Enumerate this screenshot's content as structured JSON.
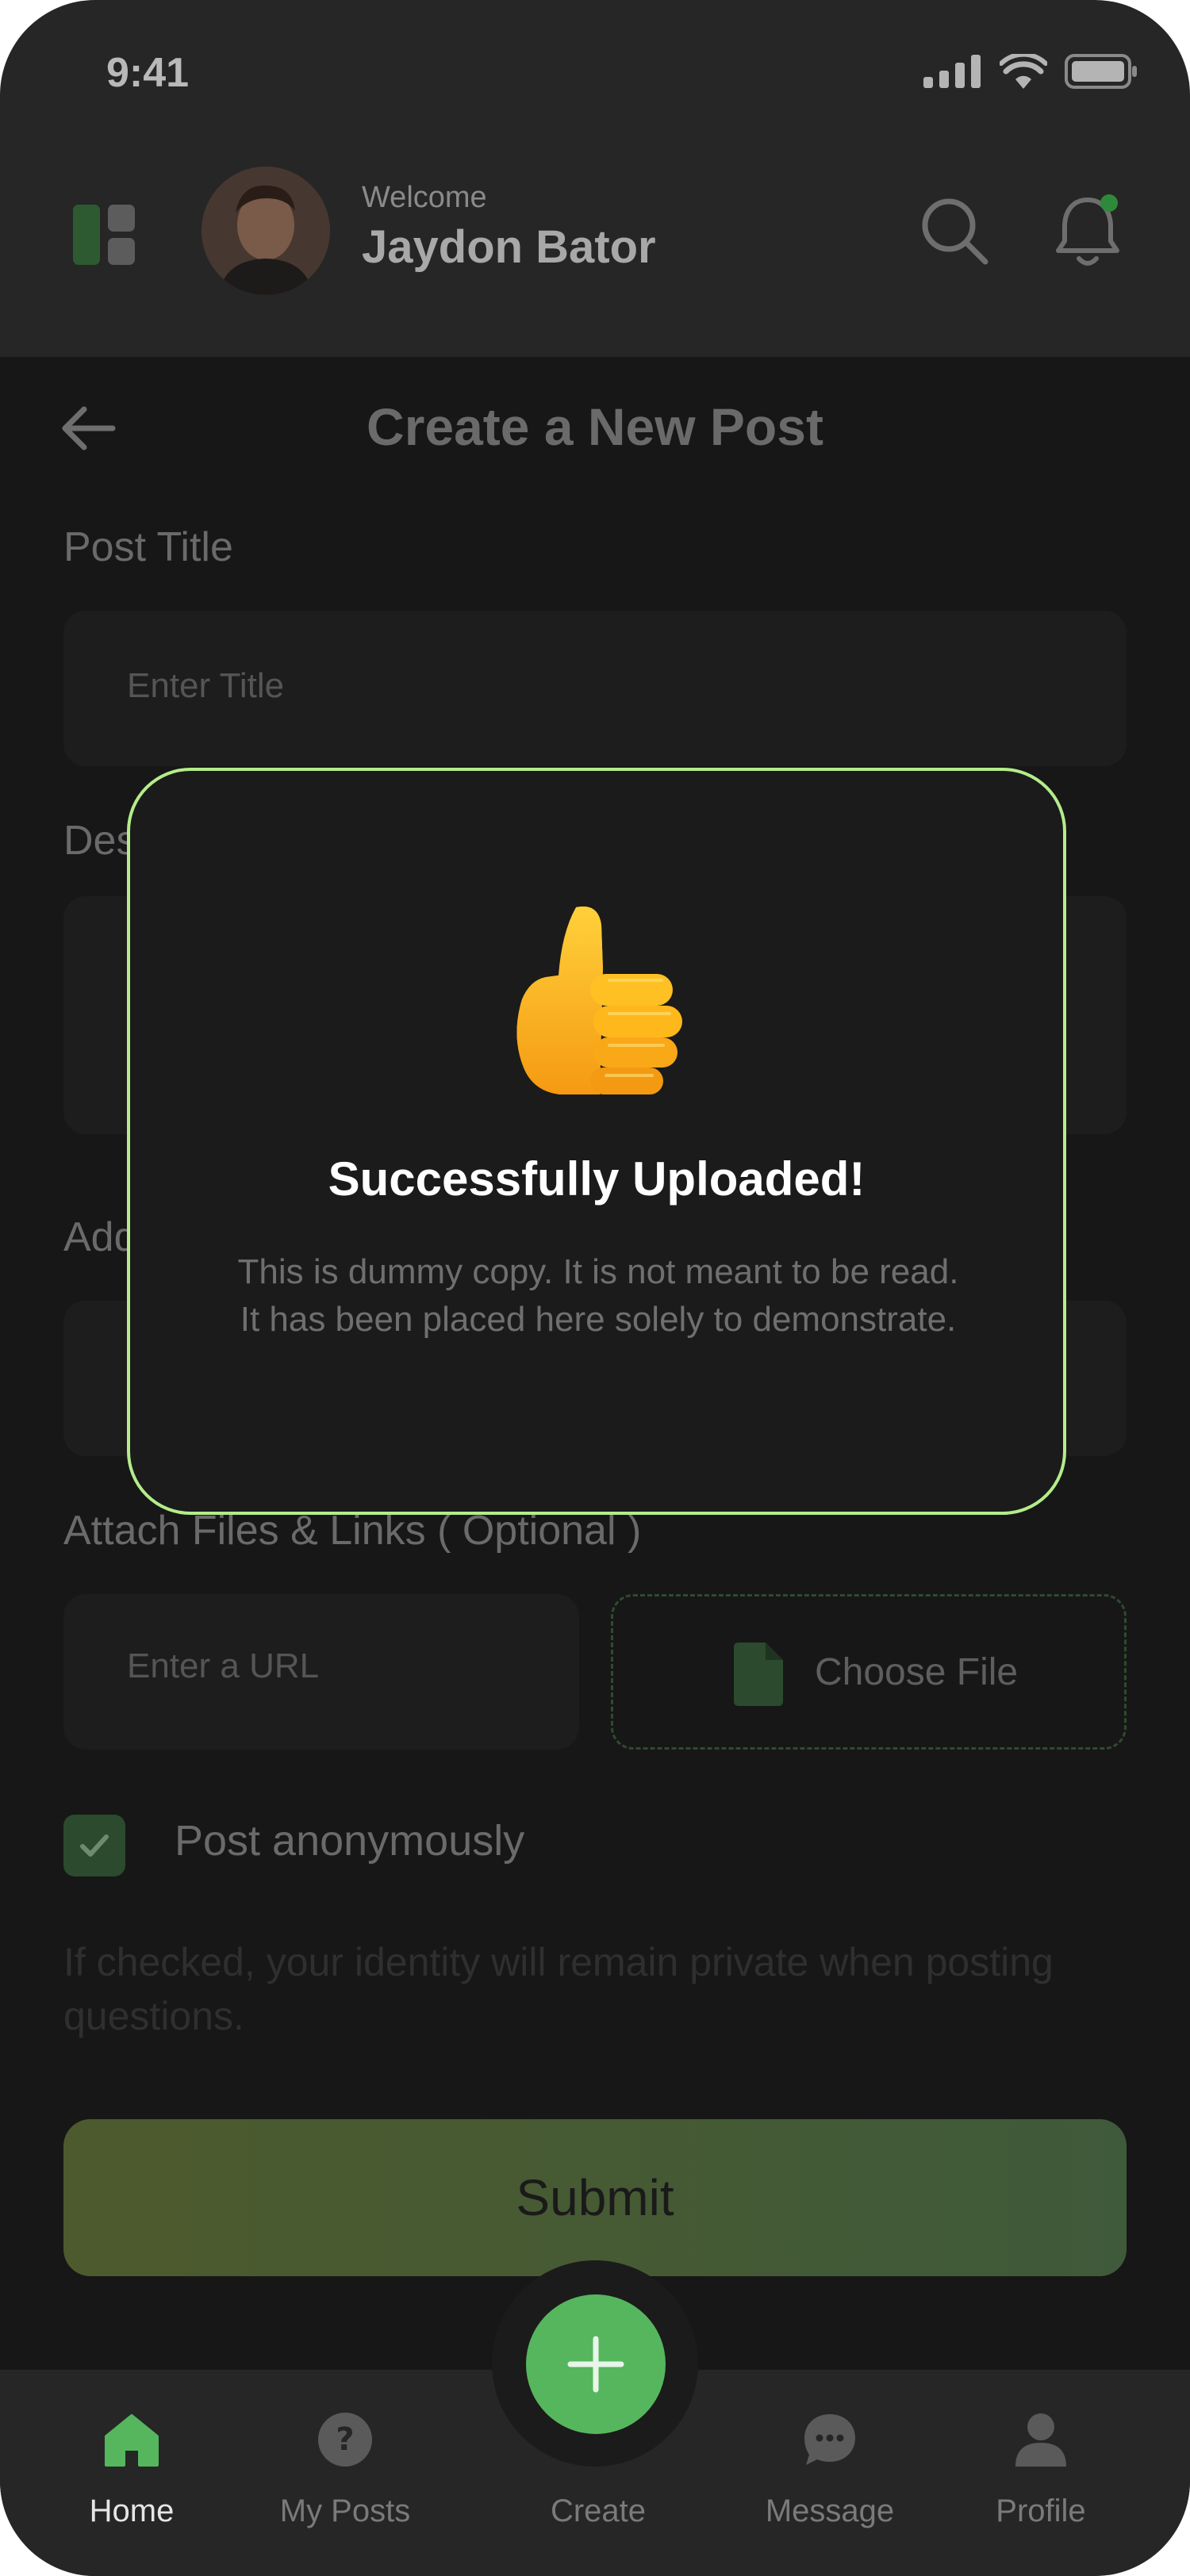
{
  "status_bar": {
    "time": "9:41"
  },
  "header": {
    "welcome": "Welcome",
    "username": "Jaydon Bator"
  },
  "page": {
    "title": "Create a New Post"
  },
  "form": {
    "post_title_label": "Post Title",
    "post_title_placeholder": "Enter Title",
    "description_label_visible": "Des",
    "address_label_visible": "Add",
    "attach_label": "Attach Files & Links ( Optional )",
    "url_placeholder": "Enter a URL",
    "choose_file_label": "Choose File",
    "anonymous_label": "Post anonymously",
    "anonymous_checked": true,
    "anonymous_helper": "If checked, your identity will remain private when posting questions.",
    "submit_label": "Submit"
  },
  "modal": {
    "title": "Successfully Uploaded!",
    "body": "This is dummy copy. It is not meant to be read. It has been placed here solely to demonstrate."
  },
  "tab_bar": {
    "items": [
      {
        "label": "Home",
        "icon": "home-icon",
        "active": true
      },
      {
        "label": "My Posts",
        "icon": "question-icon",
        "active": false
      },
      {
        "label": "Create",
        "icon": "plus-icon",
        "active": false
      },
      {
        "label": "Message",
        "icon": "chat-icon",
        "active": false
      },
      {
        "label": "Profile",
        "icon": "user-icon",
        "active": false
      }
    ]
  },
  "colors": {
    "accent_green": "#56b65e",
    "modal_border": "#b4ec8a",
    "background": "#171717"
  }
}
